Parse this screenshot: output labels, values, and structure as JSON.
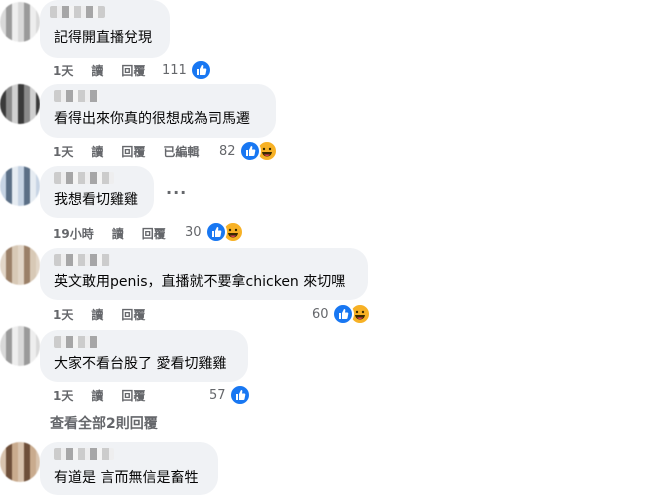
{
  "comments": [
    {
      "text": "記得開直播兌現",
      "time": "1天",
      "action_read": "讀",
      "action_reply": "回覆",
      "edited": "",
      "reaction_count": "111",
      "reactions": [
        "like-icon"
      ]
    },
    {
      "text": "看得出來你真的很想成為司馬遷",
      "time": "1天",
      "action_read": "讀",
      "action_reply": "回覆",
      "edited": "已編輯",
      "reaction_count": "82",
      "reactions": [
        "like-icon",
        "haha-icon"
      ]
    },
    {
      "text": "我想看切雞雞",
      "time": "19小時",
      "action_read": "讀",
      "action_reply": "回覆",
      "edited": "",
      "reaction_count": "30",
      "reactions": [
        "like-icon",
        "haha-icon"
      ]
    },
    {
      "text": "英文敢用penis，直播就不要拿chicken 來切嘿",
      "time": "1天",
      "action_read": "讀",
      "action_reply": "回覆",
      "edited": "",
      "reaction_count": "60",
      "reactions": [
        "like-icon",
        "haha-icon"
      ]
    },
    {
      "text": "大家不看台股了 愛看切雞雞",
      "time": "1天",
      "action_read": "讀",
      "action_reply": "回覆",
      "edited": "",
      "reaction_count": "57",
      "reactions": [
        "like-icon"
      ]
    },
    {
      "text": "有道是 言而無信是畜牲"
    }
  ],
  "view_more_replies": "查看全部2則回覆",
  "more_options": "···",
  "colors": {
    "like_blue": "#1877f2",
    "haha_yellow": "#f7b125",
    "bubble_bg": "#f0f2f5",
    "meta_grey": "#65676b"
  }
}
